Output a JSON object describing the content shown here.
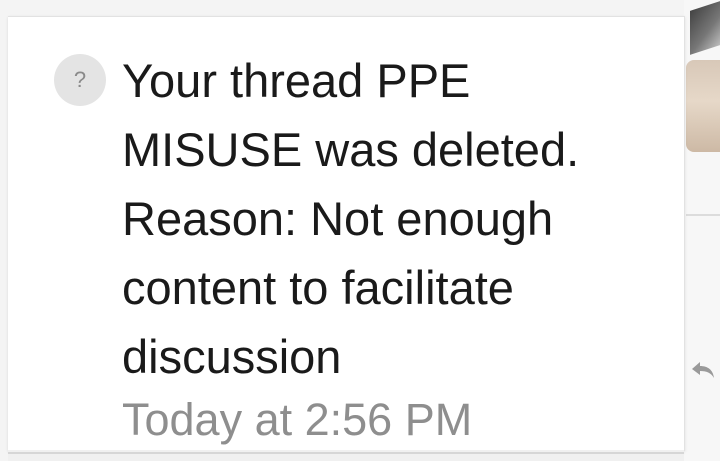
{
  "notification": {
    "avatar_glyph": "?",
    "message": "Your thread PPE MISUSE was deleted. Reason: Not enough content to facilitate discussion",
    "timestamp": "Today at 2:56 PM"
  },
  "background": {
    "arrow_icon": "reply-arrow-icon"
  }
}
